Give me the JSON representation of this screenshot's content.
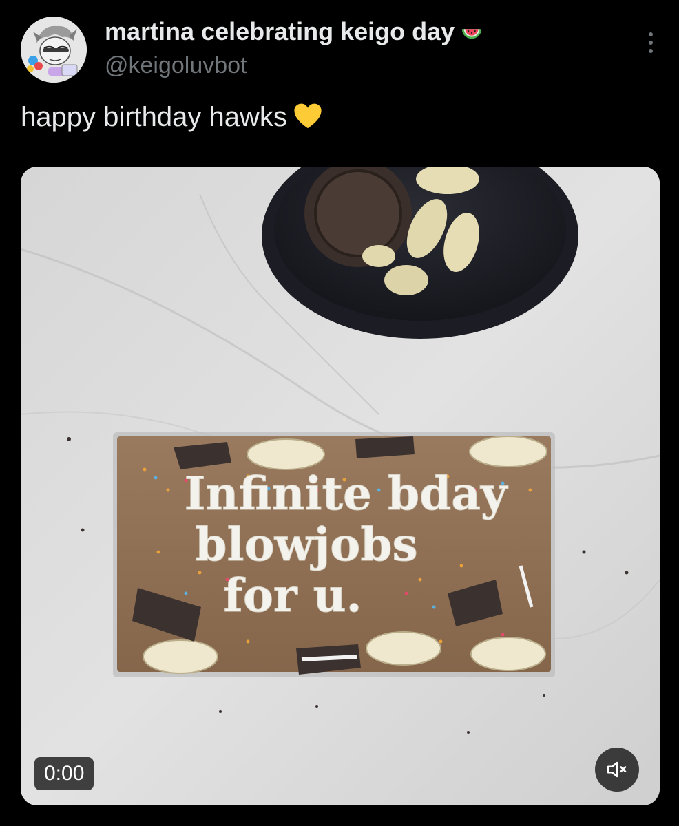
{
  "author": {
    "display_name": "martina celebrating keigo day",
    "handle": "@keigoluvbot",
    "name_emoji": "watermelon-emoji"
  },
  "tweet": {
    "text": "happy birthday hawks",
    "text_emoji": "yellow-heart-emoji"
  },
  "media": {
    "type": "video",
    "duration": "0:00",
    "muted": true,
    "overlay_text_lines": [
      "Infinite bday",
      "blowjobs",
      "for u."
    ]
  },
  "colors": {
    "background": "#000000",
    "primary_text": "#e7e9ea",
    "secondary_text": "#71767b"
  }
}
